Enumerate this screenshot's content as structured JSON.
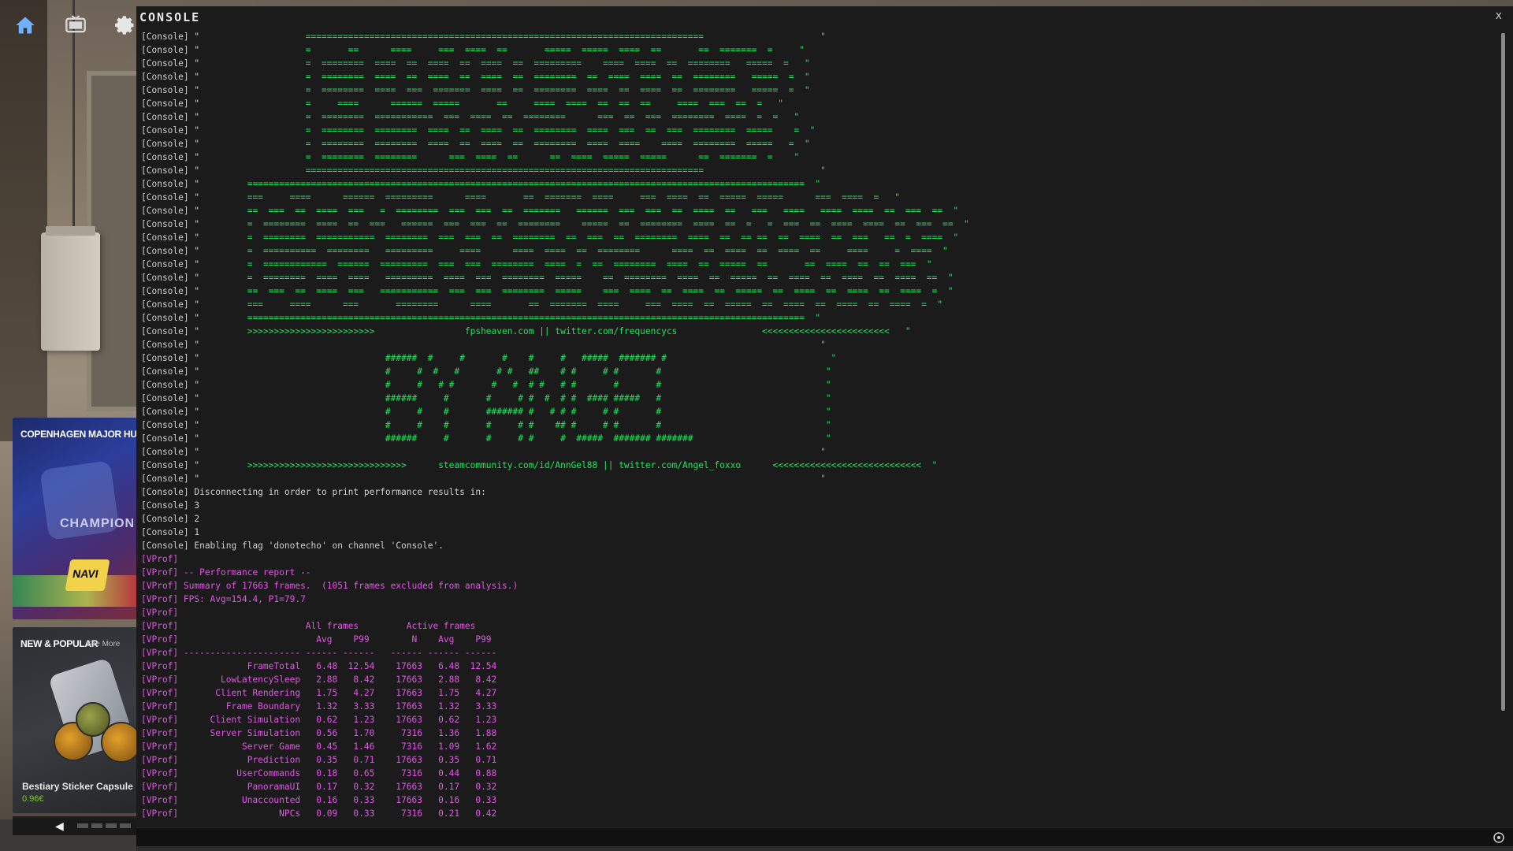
{
  "console": {
    "title": "CONSOLE",
    "close_label": "x",
    "lines": [
      {
        "kind": "art",
        "prefix": "[Console] \"",
        "art": "                    ===========================================================================                      \""
      },
      {
        "kind": "art",
        "prefix": "[Console] \"",
        "art": "                    =       ==      ====     ===  ====  ==       =====  =====  ====  ==       ==  =======  =     \""
      },
      {
        "kind": "art",
        "prefix": "[Console] \"",
        "art": "                    =  ========  ====  ==  ====  ==  ====  ==  =========    ====  ====  ==  ========   =====  =   \""
      },
      {
        "kind": "art",
        "prefix": "[Console] \"",
        "art": "                    =  ========  ====  ==  ====  ==  ====  ==  ========  ==  ====  ====  ==  ========   =====  =  \""
      },
      {
        "kind": "art",
        "prefix": "[Console] \"",
        "art": "                    =  ========  ====  ===  =======  ====  ==  ========  ====  ==  ====  ==  ========   =====  =  \""
      },
      {
        "kind": "art",
        "prefix": "[Console] \"",
        "art": "                    =     ====      ======  =====       ==     ====  ====  ==  ==  ==     ====  ===  ==  =   \""
      },
      {
        "kind": "art",
        "prefix": "[Console] \"",
        "art": "                    =  ========  ===========  ===  ====  ==  ========      ===  ==  ===  ========  ====  =  =   \""
      },
      {
        "kind": "art",
        "prefix": "[Console] \"",
        "art": "                    =  ========  ========  ====  ==  ====  ==  ========  ====  ===  ==  ===  ========  =====    =  \""
      },
      {
        "kind": "art",
        "prefix": "[Console] \"",
        "art": "                    =  ========  ========  ====  ==  ====  ==  ========  ====  ====    ====  ========  =====   =  \""
      },
      {
        "kind": "art",
        "prefix": "[Console] \"",
        "art": "                    =  ========  ========      ===  ====  ==      ==  ====  =====  =====      ==  =======  =    \""
      },
      {
        "kind": "art",
        "prefix": "[Console] \"",
        "art": "                    ===========================================================================                      \""
      },
      {
        "kind": "art",
        "prefix": "[Console] \"",
        "art": "         =========================================================================================================  \""
      },
      {
        "kind": "art",
        "prefix": "[Console] \"",
        "art": "         ===     ====      ======  =========      ====       ==  =======  ====     ===  ====  ==  =====  =====      ===  ====  =   \""
      },
      {
        "kind": "art",
        "prefix": "[Console] \"",
        "art": "         ==  ===  ==  ====  ===   =  ========  ===  ===  ==  =======   ======  ===  ===  ==  ====  ==   ===   ====   ====  ====  ==  ===  ==  \""
      },
      {
        "kind": "art",
        "prefix": "[Console] \"",
        "art": "         =  ========  ====  ==  ===   ======  ===  ===  ==  ========    =====  ==  ========  ====  ==  =   =  ===  ==  ====  ====  ==  ===  ==  \""
      },
      {
        "kind": "art",
        "prefix": "[Console] \"",
        "art": "         =  ========  ===========  ========  ===  ===  ==  ========  ==  ===  ==  ========  ====  ==  == ==  ==  ====  ==  ===   ==  =  ====  \""
      },
      {
        "kind": "art",
        "prefix": "[Console] \"",
        "art": "         =  ==========  ========   =========     ====      ====  ====  ==  ========      ====  ==  ====  ==  ====  ==     ====     =  ====  \""
      },
      {
        "kind": "art",
        "prefix": "[Console] \"",
        "art": "         =  ============  ======  =========  ===  ===  ========  ====  =  ==  ========  ====  ==  =====  ==       ==  ====  ==  ==  ===  \""
      },
      {
        "kind": "art",
        "prefix": "[Console] \"",
        "art": "         =  ========  ====  ====   =========  ====  ===  ========  =====    ==  ========  ====  ==  =====  ==  ====  ==  ====  ==  ====  ==  \""
      },
      {
        "kind": "art",
        "prefix": "[Console] \"",
        "art": "         ==  ===  ==  ====  ===   ===========  ===  ===  ========  =====    ===  ====  ==  ====  ==  =====  ==  ====  ==  ====  ==  ====  =  \""
      },
      {
        "kind": "art",
        "prefix": "[Console] \"",
        "art": "         ===     ====      ===       ========      ====       ==  =======  ====     ===  ====  ==  =====  ==  ====  ==  ====  ==  ====  =  \""
      },
      {
        "kind": "art",
        "prefix": "[Console] \"",
        "art": "         =========================================================================================================  \""
      },
      {
        "kind": "art",
        "prefix": "[Console] \"",
        "art": "         >>>>>>>>>>>>>>>>>>>>>>>>                 fpsheaven.com || twitter.com/frequencycs                <<<<<<<<<<<<<<<<<<<<<<<<   \""
      },
      {
        "kind": "art",
        "prefix": "[Console] \"",
        "art": "                                                                                                                     \""
      },
      {
        "kind": "art",
        "prefix": "[Console] \"",
        "art": "                                   ######  #     #       #    #     #   #####  ####### #                               \""
      },
      {
        "kind": "art",
        "prefix": "[Console] \"",
        "art": "                                   #     #  #   #       # #   ##    # #     # #       #                               \""
      },
      {
        "kind": "art",
        "prefix": "[Console] \"",
        "art": "                                   #     #   # #       #   #  # #   # #       #       #                               \""
      },
      {
        "kind": "art",
        "prefix": "[Console] \"",
        "art": "                                   ######     #       #     # #  #  # #  #### #####   #                               \""
      },
      {
        "kind": "art",
        "prefix": "[Console] \"",
        "art": "                                   #     #    #       ####### #   # # #     # #       #                               \""
      },
      {
        "kind": "art",
        "prefix": "[Console] \"",
        "art": "                                   #     #    #       #     # #    ## #     # #       #                               \""
      },
      {
        "kind": "art",
        "prefix": "[Console] \"",
        "art": "                                   ######     #       #     # #     #  #####  ####### #######                         \""
      },
      {
        "kind": "art",
        "prefix": "[Console] \"",
        "art": "                                                                                                                     \""
      },
      {
        "kind": "art",
        "prefix": "[Console] \"",
        "art": "         >>>>>>>>>>>>>>>>>>>>>>>>>>>>>>      steamcommunity.com/id/AnnGel88 || twitter.com/Angel_foxxo      <<<<<<<<<<<<<<<<<<<<<<<<<<<<  \""
      },
      {
        "kind": "art",
        "prefix": "[Console] \"",
        "art": "                                                                                                                     \""
      },
      {
        "kind": "plain",
        "text": "[Console] Disconnecting in order to print performance results in:"
      },
      {
        "kind": "plain",
        "text": "[Console] 3"
      },
      {
        "kind": "plain",
        "text": "[Console] 2"
      },
      {
        "kind": "plain",
        "text": "[Console] 1"
      },
      {
        "kind": "plain",
        "text": "[Console] Enabling flag 'donotecho' on channel 'Console'."
      },
      {
        "kind": "vprof",
        "text": "[VProf]"
      },
      {
        "kind": "vprof",
        "text": "[VProf] -- Performance report --"
      },
      {
        "kind": "vprof",
        "text": "[VProf] Summary of 17663 frames.  (1051 frames excluded from analysis.)"
      },
      {
        "kind": "vprof",
        "text": "[VProf] FPS: Avg=154.4, P1=79.7"
      },
      {
        "kind": "vprof",
        "text": "[VProf]"
      },
      {
        "kind": "vprof",
        "text": "[VProf]                        All frames         Active frames"
      },
      {
        "kind": "vprof",
        "text": "[VProf]                          Avg    P99        N    Avg    P99"
      },
      {
        "kind": "vprof",
        "text": "[VProf] ---------------------- ------ ------   ------ ------ ------"
      },
      {
        "kind": "vprof",
        "text": "[VProf]             FrameTotal   6.48  12.54    17663   6.48  12.54"
      },
      {
        "kind": "vprof",
        "text": "[VProf]        LowLatencySleep   2.88   8.42    17663   2.88   8.42"
      },
      {
        "kind": "vprof",
        "text": "[VProf]       Client Rendering   1.75   4.27    17663   1.75   4.27"
      },
      {
        "kind": "vprof",
        "text": "[VProf]         Frame Boundary   1.32   3.33    17663   1.32   3.33"
      },
      {
        "kind": "vprof",
        "text": "[VProf]      Client Simulation   0.62   1.23    17663   0.62   1.23"
      },
      {
        "kind": "vprof",
        "text": "[VProf]      Server Simulation   0.56   1.70     7316   1.36   1.88"
      },
      {
        "kind": "vprof",
        "text": "[VProf]            Server Game   0.45   1.46     7316   1.09   1.62"
      },
      {
        "kind": "vprof",
        "text": "[VProf]             Prediction   0.35   0.71    17663   0.35   0.71"
      },
      {
        "kind": "vprof",
        "text": "[VProf]           UserCommands   0.18   0.65     7316   0.44   0.88"
      },
      {
        "kind": "vprof",
        "text": "[VProf]             PanoramaUI   0.17   0.32    17663   0.17   0.32"
      },
      {
        "kind": "vprof",
        "text": "[VProf]            Unaccounted   0.16   0.33    17663   0.16   0.33"
      },
      {
        "kind": "vprof",
        "text": "[VProf]                   NPCs   0.09   0.33     7316   0.21   0.42"
      }
    ],
    "input_value": ""
  },
  "store": {
    "card1_title": "COPENHAGEN MAJOR HUB & ITE",
    "card1_champion": "CHAMPION",
    "card2_title": "NEW & POPULAR",
    "card2_see_more": "See More",
    "card2_item_name": "Bestiary Sticker Capsule",
    "card2_item_price": "0.96€",
    "pager_prev": "◀"
  },
  "nav": {
    "icons": [
      "home-icon",
      "tv-icon",
      "gear-icon"
    ]
  },
  "colors": {
    "console_bg": "#1b1b1b",
    "console_text": "#cfcfcf",
    "ascii_green": "#24e35c",
    "vprof_magenta": "#e156e6"
  }
}
